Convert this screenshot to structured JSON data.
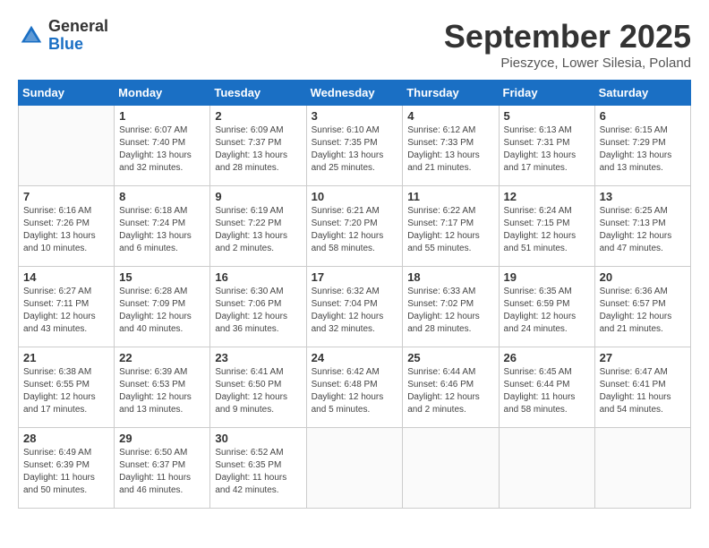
{
  "logo": {
    "general": "General",
    "blue": "Blue"
  },
  "header": {
    "month": "September 2025",
    "location": "Pieszyce, Lower Silesia, Poland"
  },
  "weekdays": [
    "Sunday",
    "Monday",
    "Tuesday",
    "Wednesday",
    "Thursday",
    "Friday",
    "Saturday"
  ],
  "weeks": [
    [
      {
        "day": "",
        "info": ""
      },
      {
        "day": "1",
        "info": "Sunrise: 6:07 AM\nSunset: 7:40 PM\nDaylight: 13 hours\nand 32 minutes."
      },
      {
        "day": "2",
        "info": "Sunrise: 6:09 AM\nSunset: 7:37 PM\nDaylight: 13 hours\nand 28 minutes."
      },
      {
        "day": "3",
        "info": "Sunrise: 6:10 AM\nSunset: 7:35 PM\nDaylight: 13 hours\nand 25 minutes."
      },
      {
        "day": "4",
        "info": "Sunrise: 6:12 AM\nSunset: 7:33 PM\nDaylight: 13 hours\nand 21 minutes."
      },
      {
        "day": "5",
        "info": "Sunrise: 6:13 AM\nSunset: 7:31 PM\nDaylight: 13 hours\nand 17 minutes."
      },
      {
        "day": "6",
        "info": "Sunrise: 6:15 AM\nSunset: 7:29 PM\nDaylight: 13 hours\nand 13 minutes."
      }
    ],
    [
      {
        "day": "7",
        "info": "Sunrise: 6:16 AM\nSunset: 7:26 PM\nDaylight: 13 hours\nand 10 minutes."
      },
      {
        "day": "8",
        "info": "Sunrise: 6:18 AM\nSunset: 7:24 PM\nDaylight: 13 hours\nand 6 minutes."
      },
      {
        "day": "9",
        "info": "Sunrise: 6:19 AM\nSunset: 7:22 PM\nDaylight: 13 hours\nand 2 minutes."
      },
      {
        "day": "10",
        "info": "Sunrise: 6:21 AM\nSunset: 7:20 PM\nDaylight: 12 hours\nand 58 minutes."
      },
      {
        "day": "11",
        "info": "Sunrise: 6:22 AM\nSunset: 7:17 PM\nDaylight: 12 hours\nand 55 minutes."
      },
      {
        "day": "12",
        "info": "Sunrise: 6:24 AM\nSunset: 7:15 PM\nDaylight: 12 hours\nand 51 minutes."
      },
      {
        "day": "13",
        "info": "Sunrise: 6:25 AM\nSunset: 7:13 PM\nDaylight: 12 hours\nand 47 minutes."
      }
    ],
    [
      {
        "day": "14",
        "info": "Sunrise: 6:27 AM\nSunset: 7:11 PM\nDaylight: 12 hours\nand 43 minutes."
      },
      {
        "day": "15",
        "info": "Sunrise: 6:28 AM\nSunset: 7:09 PM\nDaylight: 12 hours\nand 40 minutes."
      },
      {
        "day": "16",
        "info": "Sunrise: 6:30 AM\nSunset: 7:06 PM\nDaylight: 12 hours\nand 36 minutes."
      },
      {
        "day": "17",
        "info": "Sunrise: 6:32 AM\nSunset: 7:04 PM\nDaylight: 12 hours\nand 32 minutes."
      },
      {
        "day": "18",
        "info": "Sunrise: 6:33 AM\nSunset: 7:02 PM\nDaylight: 12 hours\nand 28 minutes."
      },
      {
        "day": "19",
        "info": "Sunrise: 6:35 AM\nSunset: 6:59 PM\nDaylight: 12 hours\nand 24 minutes."
      },
      {
        "day": "20",
        "info": "Sunrise: 6:36 AM\nSunset: 6:57 PM\nDaylight: 12 hours\nand 21 minutes."
      }
    ],
    [
      {
        "day": "21",
        "info": "Sunrise: 6:38 AM\nSunset: 6:55 PM\nDaylight: 12 hours\nand 17 minutes."
      },
      {
        "day": "22",
        "info": "Sunrise: 6:39 AM\nSunset: 6:53 PM\nDaylight: 12 hours\nand 13 minutes."
      },
      {
        "day": "23",
        "info": "Sunrise: 6:41 AM\nSunset: 6:50 PM\nDaylight: 12 hours\nand 9 minutes."
      },
      {
        "day": "24",
        "info": "Sunrise: 6:42 AM\nSunset: 6:48 PM\nDaylight: 12 hours\nand 5 minutes."
      },
      {
        "day": "25",
        "info": "Sunrise: 6:44 AM\nSunset: 6:46 PM\nDaylight: 12 hours\nand 2 minutes."
      },
      {
        "day": "26",
        "info": "Sunrise: 6:45 AM\nSunset: 6:44 PM\nDaylight: 11 hours\nand 58 minutes."
      },
      {
        "day": "27",
        "info": "Sunrise: 6:47 AM\nSunset: 6:41 PM\nDaylight: 11 hours\nand 54 minutes."
      }
    ],
    [
      {
        "day": "28",
        "info": "Sunrise: 6:49 AM\nSunset: 6:39 PM\nDaylight: 11 hours\nand 50 minutes."
      },
      {
        "day": "29",
        "info": "Sunrise: 6:50 AM\nSunset: 6:37 PM\nDaylight: 11 hours\nand 46 minutes."
      },
      {
        "day": "30",
        "info": "Sunrise: 6:52 AM\nSunset: 6:35 PM\nDaylight: 11 hours\nand 42 minutes."
      },
      {
        "day": "",
        "info": ""
      },
      {
        "day": "",
        "info": ""
      },
      {
        "day": "",
        "info": ""
      },
      {
        "day": "",
        "info": ""
      }
    ]
  ]
}
